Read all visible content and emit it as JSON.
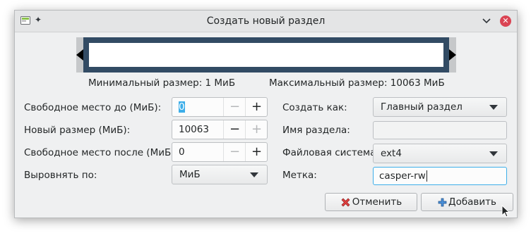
{
  "window": {
    "title": "Создать новый раздел",
    "close_glyph": "✕",
    "pin_glyph": "✦"
  },
  "partition": {
    "min_size": "Минимальный размер: 1 МиБ",
    "max_size": "Максимальный размер: 10063 МиБ"
  },
  "left": {
    "free_before": {
      "label": "Свободное место до (МиБ):",
      "value": "0",
      "minus": "−",
      "plus": "+"
    },
    "new_size": {
      "label": "Новый размер (МиБ):",
      "value": "10063",
      "minus": "−",
      "plus": "+"
    },
    "free_after": {
      "label": "Свободное место после (МиБ):",
      "value": "0",
      "minus": "−",
      "plus": "+"
    },
    "align": {
      "label": "Выровнять по:",
      "value": "МиБ"
    }
  },
  "right": {
    "create_as": {
      "label": "Создать как:",
      "value": "Главный раздел"
    },
    "partition_name": {
      "label": "Имя раздела:",
      "value": ""
    },
    "filesystem": {
      "label": "Файловая система:",
      "value": "ext4"
    },
    "label": {
      "label": "Метка:",
      "value": "casper-rw"
    }
  },
  "buttons": {
    "cancel": "Отменить",
    "add": "Добавить"
  },
  "colors": {
    "accent": "#3daee9",
    "bar": "#324b64",
    "close": "#da4453"
  }
}
